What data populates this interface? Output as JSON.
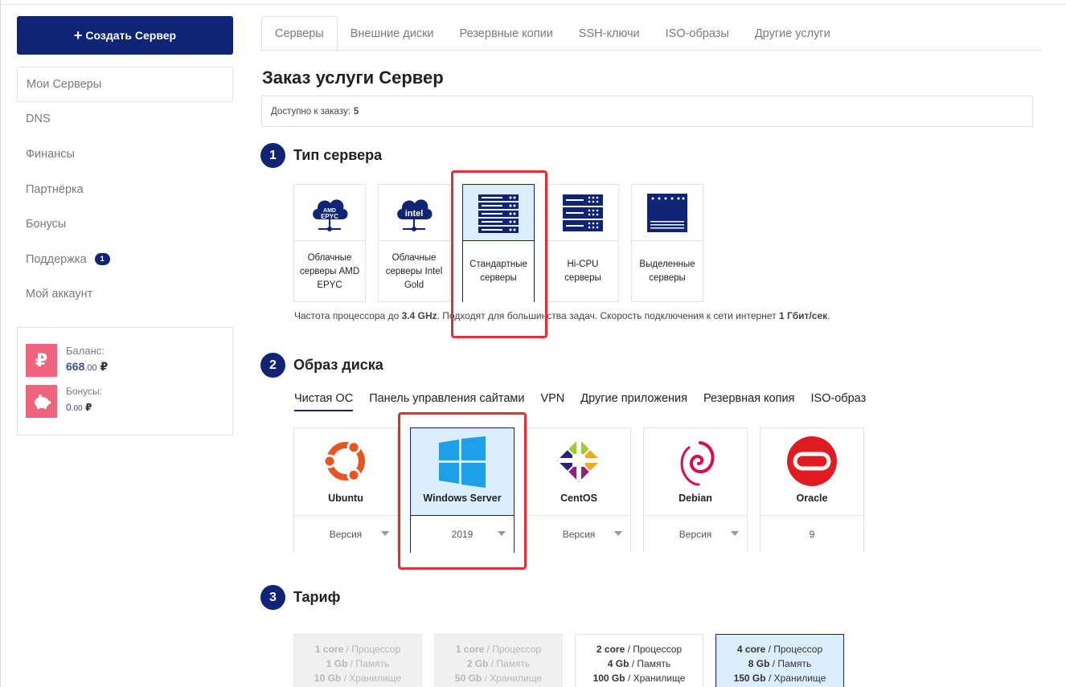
{
  "sidebar": {
    "create_button": "Создать Сервер",
    "items": [
      {
        "label": "Мои Серверы"
      },
      {
        "label": "DNS"
      },
      {
        "label": "Финансы"
      },
      {
        "label": "Партнёрка"
      },
      {
        "label": "Бонусы"
      },
      {
        "label": "Поддержка",
        "badge": "1"
      },
      {
        "label": "Мой аккаунт"
      }
    ],
    "balance": {
      "label": "Баланс:",
      "value": "668",
      "decimals": ".00",
      "currency": "₽",
      "bonus_label": "Бонусы:",
      "bonus_value": "0",
      "bonus_decimals": ".00",
      "bonus_currency": "₽"
    }
  },
  "tabs": [
    "Серверы",
    "Внешние диски",
    "Резервные копии",
    "SSH-ключи",
    "ISO-образы",
    "Другие услуги"
  ],
  "page": {
    "title": "Заказ услуги Сервер",
    "available_label": "Доступно к заказу:",
    "available_value": "5"
  },
  "section1": {
    "num": "1",
    "title": "Тип сервера",
    "cards": [
      {
        "label": "Облачные серверы AMD EPYC",
        "icon": "amd-epyc-cloud-icon"
      },
      {
        "label": "Облачные серверы Intel Gold",
        "icon": "intel-cloud-icon"
      },
      {
        "label": "Стандартные серверы",
        "icon": "server-rack-icon",
        "selected": true
      },
      {
        "label": "Hi-CPU серверы",
        "icon": "hicpu-server-icon"
      },
      {
        "label": "Выделенные серверы",
        "icon": "dedicated-server-icon"
      }
    ],
    "note_pre": "Частота процессора до",
    "note_freq": "3.4 GHz",
    "note_mid": ". Подходят для большинства задач. Скорость подключения к сети интернет",
    "note_speed": "1 Гбит/сек",
    "note_end": "."
  },
  "section2": {
    "num": "2",
    "title": "Образ диска",
    "tabs": [
      "Чистая ОС",
      "Панель управления сайтами",
      "VPN",
      "Другие приложения",
      "Резервная копия",
      "ISO-образ"
    ],
    "os": [
      {
        "name": "Ubuntu",
        "version": "Версия",
        "icon": "ubuntu-icon"
      },
      {
        "name": "Windows Server",
        "version": "2019",
        "icon": "windows-icon",
        "selected": true
      },
      {
        "name": "CentOS",
        "version": "Версия",
        "icon": "centos-icon"
      },
      {
        "name": "Debian",
        "version": "Версия",
        "icon": "debian-icon"
      },
      {
        "name": "Oracle",
        "version": "9",
        "icon": "oracle-icon"
      }
    ]
  },
  "section3": {
    "num": "3",
    "title": "Тариф",
    "cpu_unit": "core",
    "cpu_label": "/ Процессор",
    "ram_label": "/ Память",
    "disk_label": "/ Хранилище",
    "plans": [
      {
        "cpu": "1",
        "ram": "1 Gb",
        "disk": "10 Gb",
        "state": "disabled"
      },
      {
        "cpu": "1",
        "ram": "2 Gb",
        "disk": "50 Gb",
        "state": "disabled"
      },
      {
        "cpu": "2",
        "ram": "4 Gb",
        "disk": "100 Gb",
        "state": "normal"
      },
      {
        "cpu": "4",
        "ram": "8 Gb",
        "disk": "150 Gb",
        "state": "selected"
      }
    ]
  },
  "colors": {
    "brand": "#102475",
    "selected_bg": "#dbeefd",
    "highlight": "#e0302f",
    "balance_icon": "#f0647e"
  }
}
